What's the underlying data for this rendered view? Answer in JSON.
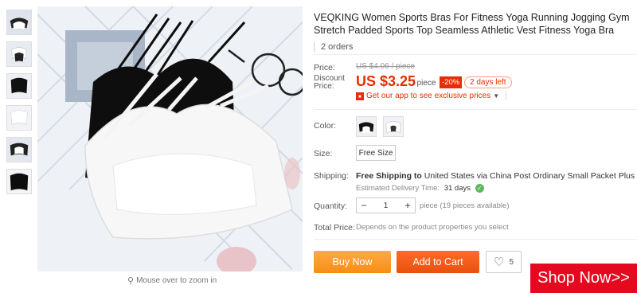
{
  "product": {
    "title": "VEQKING Women Sports Bras For Fitness Yoga Running Jogging Gym Stretch Padded Sports Top Seamless Athletic Vest Fitness Yoga Bra",
    "orders": "2 orders"
  },
  "price": {
    "label": "Price:",
    "original": "US $4.06 / piece",
    "discount_label": "Discount Price:",
    "current": "US $3.25",
    "unit": "/ piece",
    "percent_off": "-20%",
    "days_left": "2 days left",
    "app_promo": "Get our app to see exclusive prices"
  },
  "color": {
    "label": "Color:"
  },
  "size": {
    "label": "Size:",
    "value": "Free Size"
  },
  "shipping": {
    "label": "Shipping:",
    "free": "Free Shipping to",
    "detail": "United States via China Post Ordinary Small Packet Plus",
    "delivery_label": "Estimated Delivery Time:",
    "delivery_value": "31 days"
  },
  "quantity": {
    "label": "Quantity:",
    "minus": "−",
    "value": "1",
    "plus": "+",
    "available": "piece (19 pieces available)"
  },
  "total": {
    "label": "Total Price:",
    "value": "Depends on the product properties you select"
  },
  "actions": {
    "buy_now": "Buy Now",
    "add_to_cart": "Add to Cart",
    "wishlist_count": "5"
  },
  "gallery": {
    "zoom_hint": "Mouse over to zoom in"
  },
  "banner": {
    "shop_now": "Shop Now>>"
  },
  "colors": {
    "accent": "#e62e04",
    "buy": "#f88d12",
    "cart": "#e94f0c",
    "banner": "#e5091f"
  }
}
